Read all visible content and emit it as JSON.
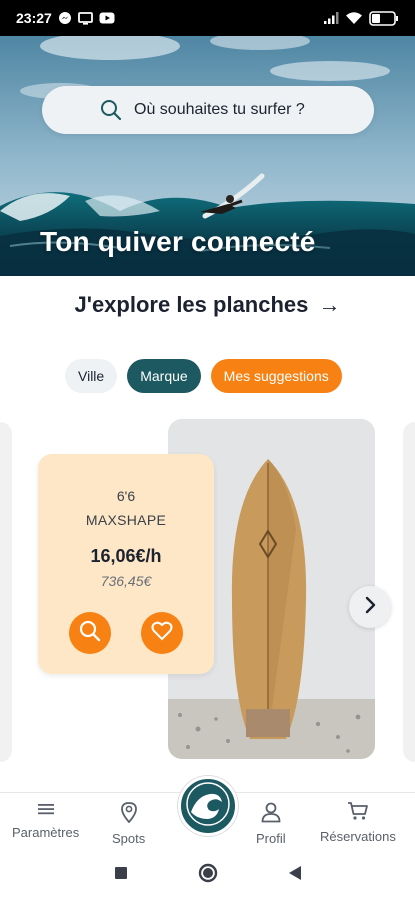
{
  "status_bar": {
    "time": "23:27",
    "battery": "31",
    "icons": [
      "messenger-icon",
      "screen-icon",
      "youtube-icon",
      "signal-icon",
      "wifi-icon",
      "battery-icon"
    ]
  },
  "hero": {
    "search_placeholder": "Où souhaites tu surfer ?",
    "title": "Ton quiver connecté"
  },
  "explore": {
    "label": "J'explore les planches",
    "arrow": "→"
  },
  "filters": [
    {
      "label": "Ville",
      "active": false
    },
    {
      "label": "Marque",
      "active": true
    },
    {
      "label": "Mes suggestions",
      "active": true
    }
  ],
  "board": {
    "size": "6'6",
    "model": "MAXSHAPE",
    "price_per_hour": "16,06€/h",
    "price": "736,45€"
  },
  "bottom_nav": {
    "items": [
      {
        "label": "Paramètres",
        "icon": "menu-icon"
      },
      {
        "label": "Spots",
        "icon": "location-pin-icon"
      },
      {
        "label": "Profil",
        "icon": "user-icon"
      },
      {
        "label": "Réservations",
        "icon": "cart-icon"
      }
    ],
    "center_icon": "wave-logo-icon"
  },
  "colors": {
    "primary": "#1c5960",
    "accent": "#f78112",
    "card": "#fde7c6",
    "chip_bg": "#eef2f4"
  }
}
